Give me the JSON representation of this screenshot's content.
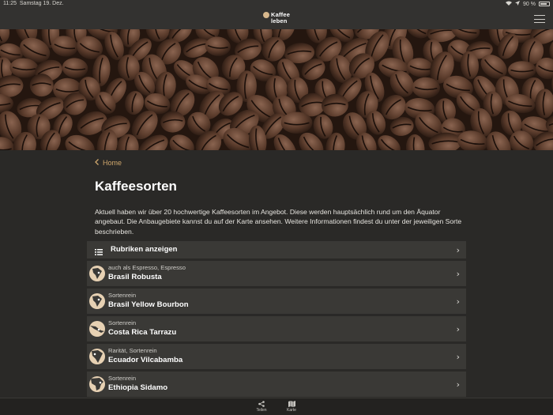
{
  "status": {
    "time": "11:25",
    "date": "Samstag 19. Dez.",
    "battery": "90 %"
  },
  "header": {
    "logo_line1": "Kaffee",
    "logo_line2": "leben"
  },
  "breadcrumb": {
    "label": "Home"
  },
  "page": {
    "title": "Kaffeesorten",
    "intro": "Aktuell haben wir über 20 hochwertige Kaffeesorten im Angebot. Diese werden hauptsächlich rund um den Äquator angebaut. Die Anbaugebiete kannst du auf der Karte ansehen. Weitere Informationen findest du unter der jeweiligen Sorte beschrieben."
  },
  "category_row": {
    "label": "Rubriken anzeigen",
    "icon": "list-icon"
  },
  "coffees": [
    {
      "sub": "auch als Espresso, Espresso",
      "name": "Brasil Robusta",
      "icon": "south-america-map-icon"
    },
    {
      "sub": "Sortenrein",
      "name": "Brasil Yellow Bourbon",
      "icon": "south-america-map-icon"
    },
    {
      "sub": "Sortenrein",
      "name": "Costa Rica Tarrazu",
      "icon": "central-america-map-icon"
    },
    {
      "sub": "Rarität, Sortenrein",
      "name": "Ecuador Vilcabamba",
      "icon": "south-america-map-icon"
    },
    {
      "sub": "Sortenrein",
      "name": "Ethiopia Sidamo",
      "icon": "africa-map-icon"
    }
  ],
  "tabs": [
    {
      "label": "Teilen",
      "icon": "share-icon"
    },
    {
      "label": "Karte",
      "icon": "map-icon"
    }
  ],
  "colors": {
    "accent": "#cfa76c",
    "background": "#2a2927",
    "row": "#3a3936",
    "header": "#333230"
  }
}
